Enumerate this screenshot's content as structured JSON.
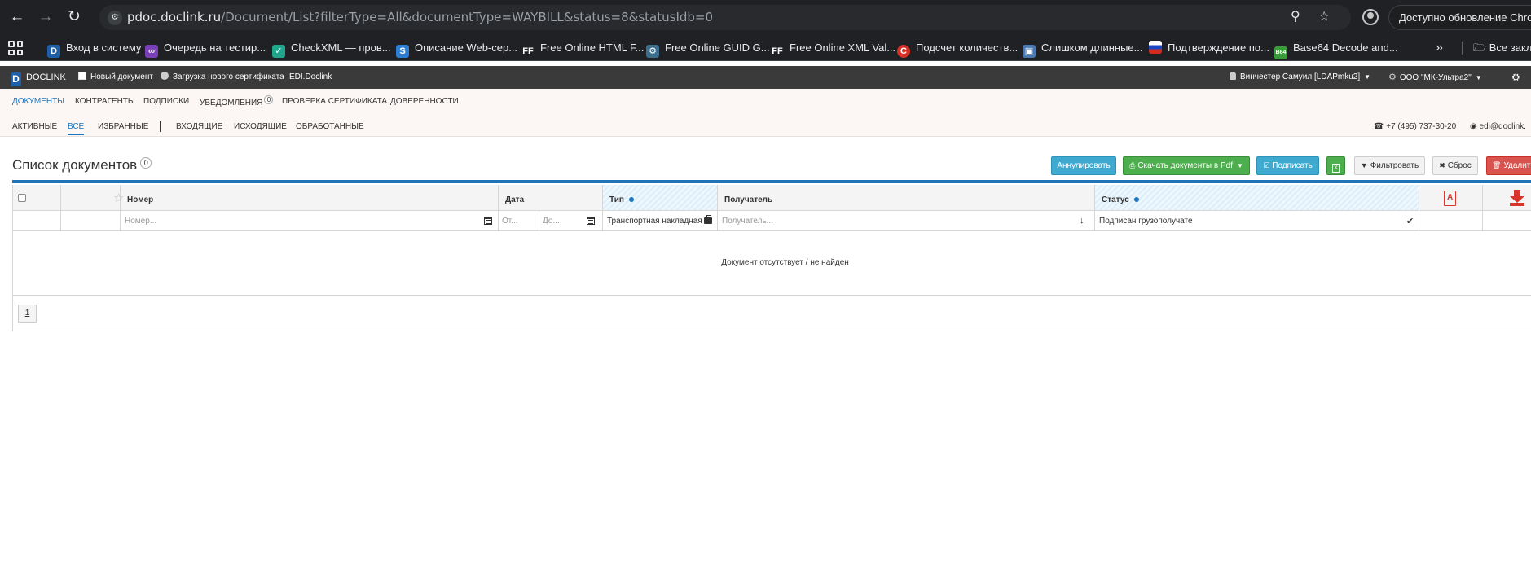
{
  "browser": {
    "url_host": "pdoc.doclink.ru",
    "url_path": "/Document/List?filterType=All&documentType=WAYBILL&status=8&statusIdb=0",
    "update_label": "Доступно обновление Chrome",
    "bookmarks": [
      {
        "label": "Вход в систему",
        "icon": "doclink-logo-icon"
      },
      {
        "label": "Очередь на тестир...",
        "icon": "visual-studio-icon"
      },
      {
        "label": "CheckXML — пров...",
        "icon": "checkxml-icon"
      },
      {
        "label": "Описание Web-сер...",
        "icon": "vs-code-icon"
      },
      {
        "label": "Free Online HTML F...",
        "icon": "ff-icon"
      },
      {
        "label": "Free Online GUID G...",
        "icon": "gear-icon"
      },
      {
        "label": "Free Online XML Val...",
        "icon": "ff-icon"
      },
      {
        "label": "Подсчет количеств...",
        "icon": "copyright-icon"
      },
      {
        "label": "Слишком длинные...",
        "icon": "window-icon"
      },
      {
        "label": "Подтверждение по...",
        "icon": "russia-flag-icon"
      },
      {
        "label": "Base64 Decode and...",
        "icon": "base64-icon"
      }
    ],
    "bookmarks_folder": "Все закл"
  },
  "topbar": {
    "brand": "DOCLINK",
    "brand_letter": "D",
    "new_document": "Новый документ",
    "upload_certificate": "Загрузка нового сертификата",
    "edi": "EDI.Doclink",
    "user": "Винчестер Самуил [LDAPmku2]",
    "organization": "ООО \"МК-Ультра2\""
  },
  "nav": {
    "documents": "ДОКУМЕНТЫ",
    "contractors": "КОНТРАГЕНТЫ",
    "subscriptions": "ПОДПИСКИ",
    "notifications": "УВЕДОМЛЕНИЯ",
    "notifications_count": "0",
    "check_certificate": "ПРОВЕРКА СЕРТИФИКАТА",
    "powers": "ДОВЕРЕННОСТИ"
  },
  "subnav": {
    "active": "АКТИВНЫЕ",
    "all": "ВСЕ",
    "favorites": "ИЗБРАННЫЕ",
    "incoming": "ВХОДЯЩИЕ",
    "outgoing": "ИСХОДЯЩИЕ",
    "processed": "ОБРАБОТАННЫЕ",
    "phone": "+7 (495) 737-30-20",
    "email": "edi@doclink."
  },
  "page": {
    "title": "Список документов",
    "count": "0",
    "buttons": {
      "cancel": "Аннулировать",
      "download_pdf": "Скачать документы в Pdf",
      "sign": "Подписать",
      "filter": "Фильтровать",
      "reset": "Сброс",
      "delete": "Удалить"
    }
  },
  "table": {
    "columns": {
      "number": "Номер",
      "date": "Дата",
      "type": "Тип",
      "recipient": "Получатель",
      "status": "Статус"
    },
    "filters": {
      "number_placeholder": "Номер...",
      "date_from": "От...",
      "date_to": "До...",
      "type_value": "Транспортная накладная",
      "recipient_placeholder": "Получатель...",
      "status_value": "Подписан грузополучате"
    },
    "empty_message": "Документ отсутствует / не найден",
    "current_page": "1"
  },
  "colors": {
    "accent": "#1c75bc",
    "info": "#3fa9cf",
    "success": "#4cae4c",
    "danger": "#d9534f"
  }
}
